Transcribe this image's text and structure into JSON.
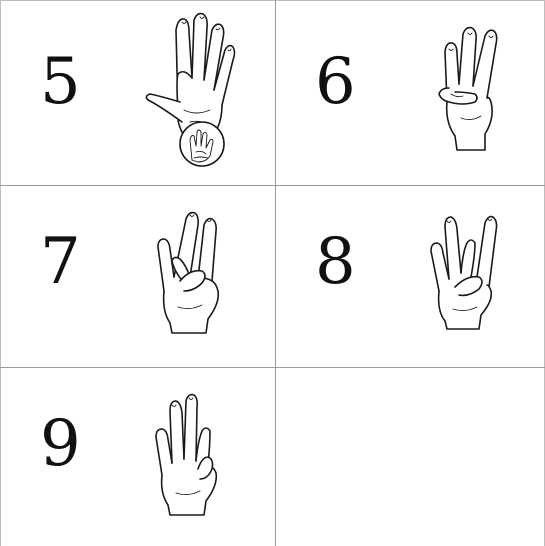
{
  "cards": [
    {
      "numeral": "5",
      "icon": "open-hand-five-fingers-icon"
    },
    {
      "numeral": "6",
      "icon": "hand-sign-six-icon"
    },
    {
      "numeral": "7",
      "icon": "hand-sign-seven-icon"
    },
    {
      "numeral": "8",
      "icon": "hand-sign-eight-icon"
    },
    {
      "numeral": "9",
      "icon": "hand-sign-nine-icon"
    }
  ]
}
